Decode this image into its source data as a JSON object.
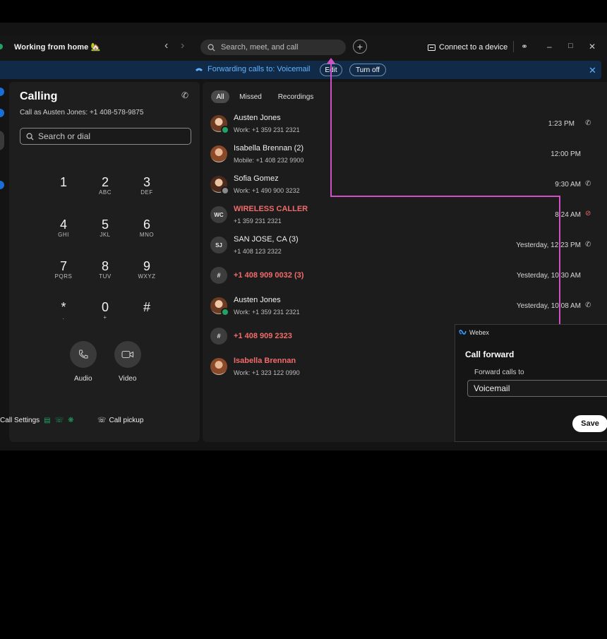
{
  "window": {
    "status_title": "Working from home 🏡",
    "search_placeholder": "Search, meet, and call",
    "connect_label": "Connect to a device"
  },
  "banner": {
    "text": "Forwarding calls to: Voicemail",
    "edit_label": "Edit",
    "turnoff_label": "Turn off"
  },
  "calling": {
    "title": "Calling",
    "call_as": "Call as Austen Jones: +1 408-578-9875",
    "search_placeholder": "Search or dial",
    "keys": [
      {
        "d": "1",
        "l": ""
      },
      {
        "d": "2",
        "l": "ABC"
      },
      {
        "d": "3",
        "l": "DEF"
      },
      {
        "d": "4",
        "l": "GHI"
      },
      {
        "d": "5",
        "l": "JKL"
      },
      {
        "d": "6",
        "l": "MNO"
      },
      {
        "d": "7",
        "l": "PQRS"
      },
      {
        "d": "8",
        "l": "TUV"
      },
      {
        "d": "9",
        "l": "WXYZ"
      },
      {
        "d": "*",
        "l": "."
      },
      {
        "d": "0",
        "l": "+"
      },
      {
        "d": "#",
        "l": ""
      }
    ],
    "audio_label": "Audio",
    "video_label": "Video",
    "call_settings": "Call Settings",
    "call_pickup": "Call pickup"
  },
  "history": {
    "filters": [
      "All",
      "Missed",
      "Recordings"
    ],
    "rows": [
      {
        "name": "Austen Jones",
        "sub": "Work: +1 359 231 2321",
        "time": "1:23 PM",
        "missed": false
      },
      {
        "name": "Isabella Brennan (2)",
        "sub": "Mobile: +1 408 232 9900",
        "time": "12:00 PM",
        "missed": false
      },
      {
        "name": "Sofia Gomez",
        "sub": "Work: +1 490 900 3232",
        "time": "9:30 AM",
        "missed": false
      },
      {
        "name": "WIRELESS CALLER",
        "sub": "+1 359 231 2321",
        "time": "8:24 AM",
        "missed": true,
        "initials": "WC"
      },
      {
        "name": "SAN JOSE, CA (3)",
        "sub": "+1 408 123 2322",
        "time": "Yesterday, 12:23 PM",
        "missed": false,
        "initials": "SJ"
      },
      {
        "name": "+1 408 909 0032 (3)",
        "sub": "",
        "time": "Yesterday, 10:30 AM",
        "missed": true,
        "initials": "#"
      },
      {
        "name": "Austen Jones",
        "sub": "Work: +1 359 231 2321",
        "time": "Yesterday, 10:08 AM",
        "missed": false
      },
      {
        "name": "+1 408 909 2323",
        "sub": "",
        "time": "",
        "missed": true,
        "initials": "#"
      },
      {
        "name": "Isabella Brennan",
        "sub": "Work: +1 323 122 0990",
        "time": "",
        "missed": true
      }
    ]
  },
  "popup": {
    "app_name": "Webex",
    "title": "Call forward",
    "label": "Forward calls to",
    "value": "Voicemail",
    "save_label": "Save"
  },
  "colors": {
    "accent": "#62b3ff",
    "missed": "#f26b6b",
    "annotation": "#d24fc6",
    "presence": "#21a366"
  }
}
